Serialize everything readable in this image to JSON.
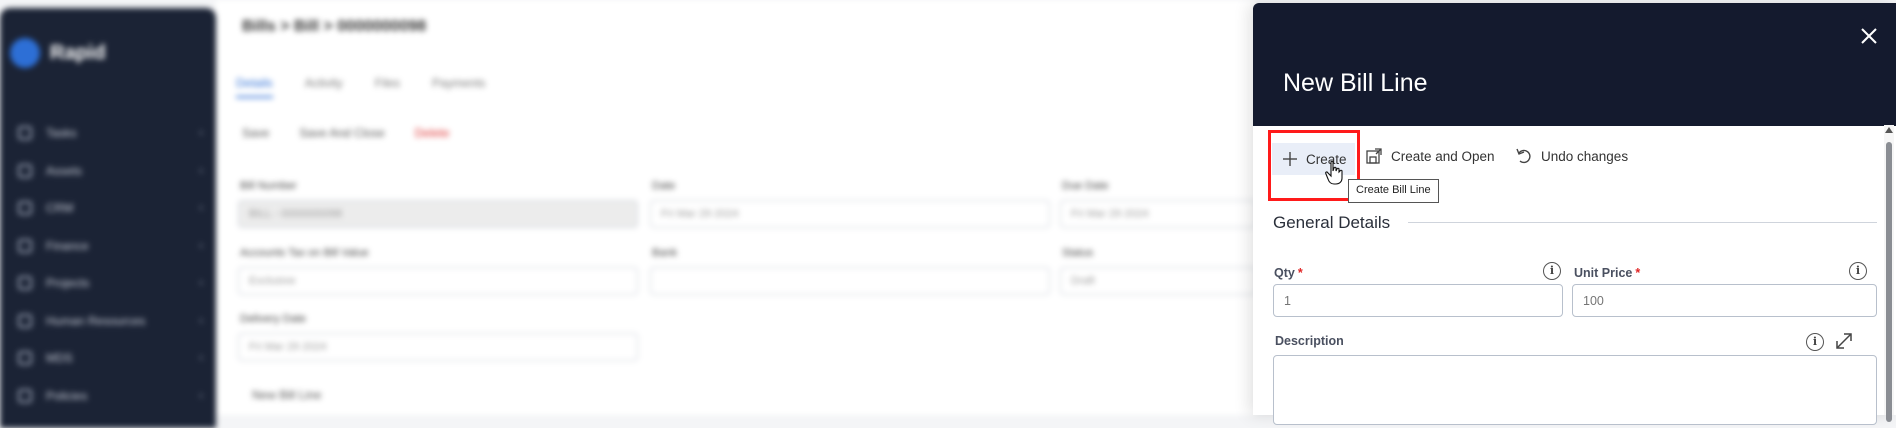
{
  "background": {
    "app_name": "Rapid",
    "breadcrumb": "Bills > Bill > 0000000098",
    "nav_items": [
      "Tasks",
      "Assets",
      "CRM",
      "Finance",
      "Projects",
      "Human Resources",
      "MDS",
      "Policies"
    ],
    "tabs": [
      "Details",
      "Activity",
      "Files",
      "Payments"
    ],
    "toolbar": [
      "Save",
      "Save And Close",
      "Delete"
    ],
    "fields": [
      {
        "label": "Bill Number",
        "value": "BILL - 0000000098"
      },
      {
        "label": "Date",
        "value": "Fri Mar 29 2024"
      },
      {
        "label": "Due Date",
        "value": "Fri Mar 29 2024"
      },
      {
        "label": "Accounts Tax on Bill Value",
        "value": "Exclusive"
      },
      {
        "label": "Bank",
        "value": ""
      },
      {
        "label": "Status",
        "value": "Draft"
      },
      {
        "label": "Delivery Date",
        "value": "Fri Mar 29 2024"
      }
    ],
    "new_line": "New Bill Line"
  },
  "panel": {
    "title": "New Bill Line",
    "toolbar": {
      "create_label": "Create",
      "create_open_label": "Create and Open",
      "undo_label": "Undo changes"
    },
    "tooltip": "Create Bill Line",
    "section_title": "General Details",
    "fields": {
      "qty": {
        "label": "Qty",
        "placeholder": "1"
      },
      "unit_price": {
        "label": "Unit Price",
        "placeholder": "100"
      },
      "description": {
        "label": "Description"
      }
    },
    "required_mark": "*"
  }
}
